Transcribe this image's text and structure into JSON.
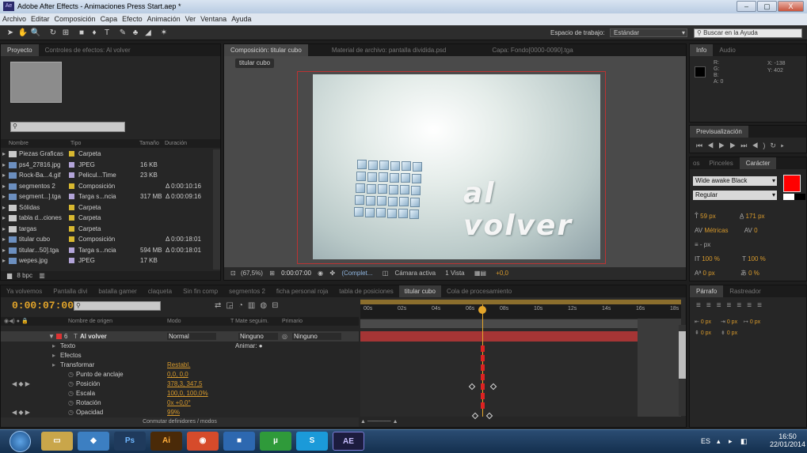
{
  "window": {
    "title": "Adobe After Effects - Animaciones Press Start.aep *",
    "minimize": "–",
    "maximize": "▢",
    "close": "X"
  },
  "menu": [
    "Archivo",
    "Editar",
    "Composición",
    "Capa",
    "Efecto",
    "Animación",
    "Ver",
    "Ventana",
    "Ayuda"
  ],
  "toolbar": {
    "workspace_label": "Espacio de trabajo:",
    "workspace_value": "Estándar",
    "help_placeholder": "Buscar en la Ayuda"
  },
  "project": {
    "tabs": [
      "Proyecto",
      "Controles de efectos: Al volver"
    ],
    "columns": [
      "Nombre",
      "Tipo",
      "Tamaño",
      "Duración"
    ],
    "items": [
      {
        "name": "Piezas Graficas",
        "type": "Carpeta",
        "size": "",
        "dur": "",
        "color": "#d8b830"
      },
      {
        "name": "ps4_27816.jpg",
        "type": "JPEG",
        "size": "16 KB",
        "dur": "",
        "color": "#b2a4d8"
      },
      {
        "name": "Rock-Ba...4.gif",
        "type": "Pelicul...Time",
        "size": "23 KB",
        "dur": "",
        "color": "#b2a4d8"
      },
      {
        "name": "segmentos 2",
        "type": "Composición",
        "size": "",
        "dur": "Δ 0:00:10:16",
        "color": "#d8b830"
      },
      {
        "name": "segment...].tga",
        "type": "Targa s...ncia",
        "size": "317 MB",
        "dur": "Δ 0:00:09:16",
        "color": "#b2a4d8"
      },
      {
        "name": "Sólidas",
        "type": "Carpeta",
        "size": "",
        "dur": "",
        "color": "#d8b830"
      },
      {
        "name": "tabla d...ciones",
        "type": "Carpeta",
        "size": "",
        "dur": "",
        "color": "#d8b830"
      },
      {
        "name": "targas",
        "type": "Carpeta",
        "size": "",
        "dur": "",
        "color": "#d8b830"
      },
      {
        "name": "titular cubo",
        "type": "Composición",
        "size": "",
        "dur": "Δ 0:00:18:01",
        "color": "#d8b830"
      },
      {
        "name": "titular...50].tga",
        "type": "Targa s...ncia",
        "size": "594 MB",
        "dur": "Δ 0:00:18:01",
        "color": "#b2a4d8"
      },
      {
        "name": "wepes.jpg",
        "type": "JPEG",
        "size": "17 KB",
        "dur": "",
        "color": "#b2a4d8"
      }
    ],
    "footer_bpc": "8 bpc"
  },
  "composition": {
    "tabs": [
      "Composición: titular cubo",
      "Material de archivo: pantalla dividida.psd",
      "Capa: Fondo[0000-0090].tga"
    ],
    "subtab": "titular cubo",
    "canvas_text": "al volver",
    "footer": {
      "zoom": "(67,5%)",
      "time": "0:00:07:00",
      "quality": "(Complet...",
      "camera": "Cámara activa",
      "views": "1 Vista",
      "exposure": "+0,0"
    }
  },
  "info": {
    "tabs": [
      "Info",
      "Audio"
    ],
    "r": "R:",
    "g": "G:",
    "b": "B:",
    "a": "A: 0",
    "x": "X: -138",
    "y": "Y: 402"
  },
  "preview": {
    "tab": "Previsualización"
  },
  "character": {
    "tabs": [
      "os",
      "Pinceles",
      "Carácter"
    ],
    "font": "Wide awake Black",
    "style": "Regular",
    "size": "59 px",
    "leading": "171 px",
    "kerning": "Métricas",
    "tracking": "0",
    "stroke": "- px",
    "vscale": "100 %",
    "hscale": "100 %",
    "baseline": "0 px",
    "tsume": "0 %",
    "fill_color": "#ff0000"
  },
  "paragraph": {
    "tabs": [
      "Párrafo",
      "Rastreador"
    ],
    "v1": "0 px",
    "v2": "0 px",
    "v3": "0 px",
    "v4": "0 px",
    "v5": "0 px"
  },
  "timeline": {
    "tabs": [
      "Ya volvemos",
      "Pantalla divi",
      "batalla gamer",
      "claqueta",
      "Sin fin comp",
      "segmentos 2",
      "ficha personal roja",
      "tabla de posiciones",
      "titular cubo",
      "Cola de procesamiento"
    ],
    "time": "0:00:07:00",
    "columns": [
      "Nombre de origen",
      "Modo",
      "T  Mate seguim.",
      "Primario"
    ],
    "ruler": [
      "00s",
      "02s",
      "04s",
      "06s",
      "08s",
      "10s",
      "12s",
      "14s",
      "16s",
      "18s"
    ],
    "layer": {
      "num": "6",
      "name": "Al volver",
      "mode": "Normal",
      "matte": "Ninguno",
      "parent": "Ninguno"
    },
    "props": [
      {
        "name": "Texto",
        "value": "",
        "indent": 1
      },
      {
        "name": "Efectos",
        "value": "",
        "indent": 1
      },
      {
        "name": "Transformar",
        "value": "Restabl.",
        "indent": 1
      },
      {
        "name": "Punto de anclaje",
        "value": "0,0, 0,0",
        "indent": 2
      },
      {
        "name": "Posición",
        "value": "378,3, 347,5",
        "indent": 2
      },
      {
        "name": "Escala",
        "value": "100,0, 100,0%",
        "indent": 2
      },
      {
        "name": "Rotación",
        "value": "0x +0,0°",
        "indent": 2
      },
      {
        "name": "Opacidad",
        "value": "99%",
        "indent": 2
      }
    ],
    "animate_label": "Animar:",
    "footer": "Conmutar definidores / modos"
  },
  "taskbar": {
    "apps": [
      "Ps",
      "Ai",
      "AE"
    ],
    "lang": "ES",
    "clock_time": "16:50",
    "clock_date": "22/01/2014"
  }
}
